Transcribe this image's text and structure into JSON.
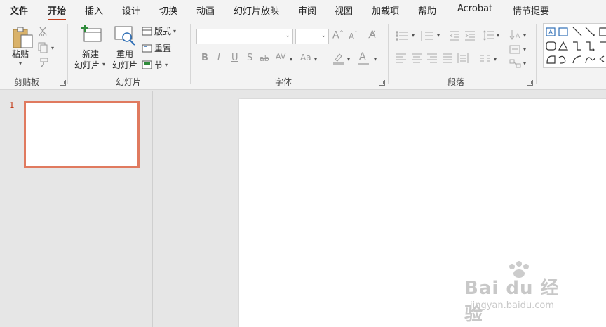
{
  "menu": {
    "tabs": [
      "文件",
      "开始",
      "插入",
      "设计",
      "切换",
      "动画",
      "幻灯片放映",
      "审阅",
      "视图",
      "加载项",
      "帮助",
      "Acrobat",
      "情节提要"
    ],
    "active_tab": "开始"
  },
  "ribbon": {
    "clipboard": {
      "paste_label": "粘贴",
      "group_label": "剪贴板"
    },
    "slides": {
      "new_slide_line1": "新建",
      "new_slide_line2": "幻灯片",
      "reuse_line1": "重用",
      "reuse_line2": "幻灯片",
      "layout_label": "版式",
      "reset_label": "重置",
      "section_label": "节",
      "group_label": "幻灯片"
    },
    "font": {
      "font_name_value": "",
      "font_size_value": "",
      "bold": "B",
      "italic": "I",
      "underline": "U",
      "shadow": "S",
      "strike": "ab",
      "spacing": "AV",
      "case": "Aa",
      "font_color": "A",
      "grow": "A",
      "shrink": "A",
      "group_label": "字体"
    },
    "paragraph": {
      "group_label": "段落"
    }
  },
  "slide_panel": {
    "slide_number": "1"
  },
  "watermark": {
    "main": "Bai du 经验",
    "sub": "jingyan.baidu.com"
  },
  "colors": {
    "accent": "#c43e1c",
    "thumb_border": "#e07a5f",
    "ribbon_bg": "#f3f3f3",
    "workspace_bg": "#e6e6e6"
  }
}
